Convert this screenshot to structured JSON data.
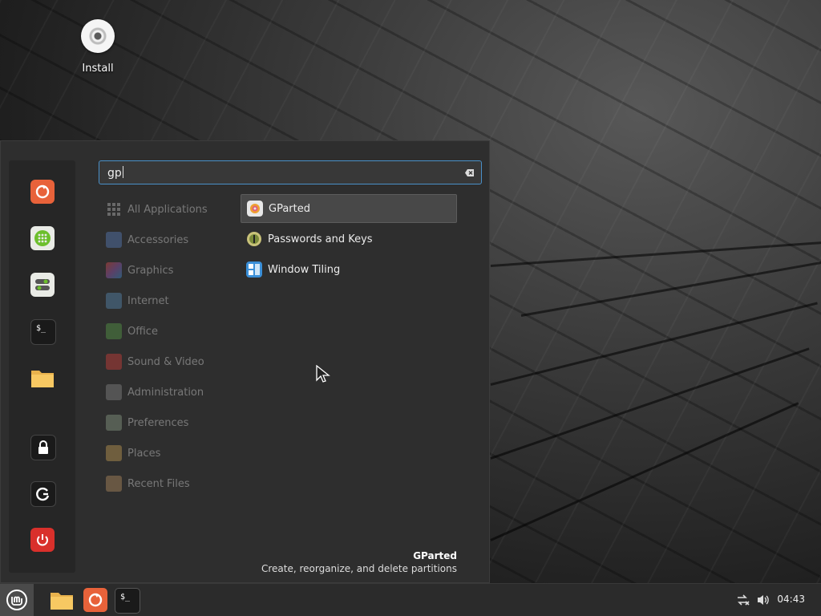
{
  "desktop": {
    "icons": [
      {
        "label": "Install",
        "icon": "disc-icon"
      }
    ]
  },
  "menu": {
    "search": {
      "value": "gp",
      "placeholder": ""
    },
    "favorites": [
      {
        "name": "firefox",
        "icon": "firefox-icon"
      },
      {
        "name": "software-manager",
        "icon": "grid-icon"
      },
      {
        "name": "system-settings",
        "icon": "toggles-icon"
      },
      {
        "name": "terminal",
        "icon": "terminal-icon"
      },
      {
        "name": "files",
        "icon": "folder-icon"
      },
      {
        "name": "lock-screen",
        "icon": "lock-icon"
      },
      {
        "name": "logout",
        "icon": "logout-icon"
      },
      {
        "name": "shutdown",
        "icon": "power-icon"
      }
    ],
    "categories": [
      {
        "label": "All Applications",
        "icon": "grid-dots-icon"
      },
      {
        "label": "Accessories",
        "icon": "accessories-icon"
      },
      {
        "label": "Graphics",
        "icon": "graphics-icon"
      },
      {
        "label": "Internet",
        "icon": "cloud-icon"
      },
      {
        "label": "Office",
        "icon": "office-icon"
      },
      {
        "label": "Sound & Video",
        "icon": "play-icon"
      },
      {
        "label": "Administration",
        "icon": "admin-icon"
      },
      {
        "label": "Preferences",
        "icon": "preferences-icon"
      },
      {
        "label": "Places",
        "icon": "folder-icon"
      },
      {
        "label": "Recent Files",
        "icon": "recent-icon"
      }
    ],
    "apps": [
      {
        "label": "GParted",
        "icon": "gparted-icon",
        "selected": true
      },
      {
        "label": "Passwords and Keys",
        "icon": "keys-icon",
        "selected": false
      },
      {
        "label": "Window Tiling",
        "icon": "tiling-icon",
        "selected": false
      }
    ],
    "description": {
      "title": "GParted",
      "text": "Create, reorganize, and delete partitions"
    }
  },
  "panel": {
    "taskbar": [
      {
        "name": "files",
        "icon": "folder-icon"
      },
      {
        "name": "firefox",
        "icon": "firefox-icon"
      },
      {
        "name": "terminal",
        "icon": "terminal-icon"
      }
    ],
    "tray": {
      "network_icon": "network-disconnected-icon",
      "volume_icon": "volume-icon"
    },
    "clock": "04:43"
  },
  "colors": {
    "accent": "#4a90c8",
    "firefox": "#e8623a",
    "shutdown": "#d9302b",
    "mint_green": "#6cbf2c"
  }
}
